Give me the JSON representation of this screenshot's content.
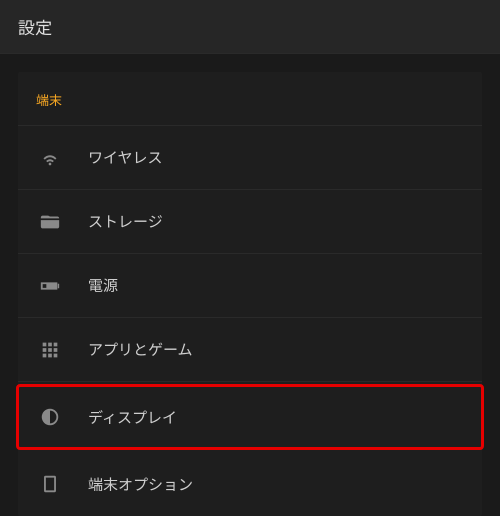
{
  "header": {
    "title": "設定"
  },
  "section": {
    "title": "端末"
  },
  "items": [
    {
      "label": "ワイヤレス"
    },
    {
      "label": "ストレージ"
    },
    {
      "label": "電源"
    },
    {
      "label": "アプリとゲーム"
    },
    {
      "label": "ディスプレイ"
    },
    {
      "label": "端末オプション"
    }
  ]
}
